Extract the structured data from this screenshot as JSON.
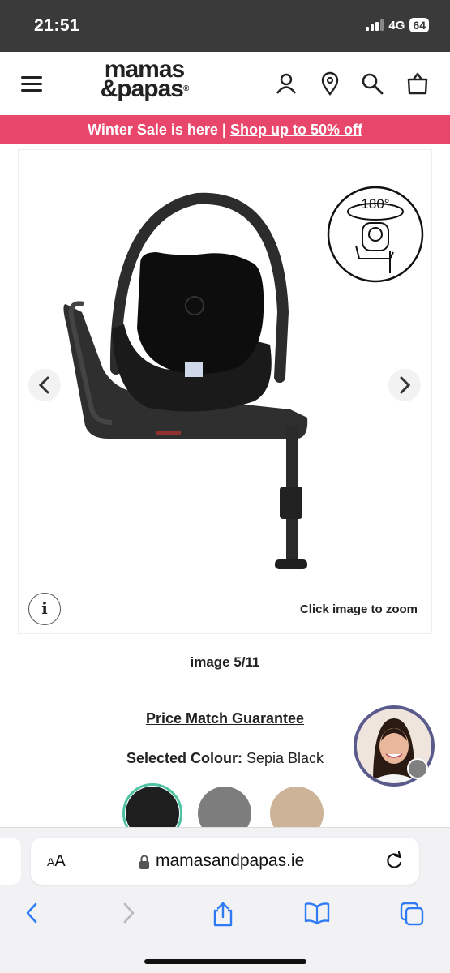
{
  "status_bar": {
    "time": "21:51",
    "network": "4G",
    "battery": "64"
  },
  "header": {
    "logo_line1": "mamas",
    "logo_line2": "&papas",
    "logo_reg": "®",
    "icons": [
      "menu-icon",
      "account-icon",
      "store-locator-icon",
      "search-icon",
      "bag-icon"
    ]
  },
  "promo": {
    "text": "Winter Sale is here | ",
    "link": "Shop up to 50% off",
    "color": "#e8476b"
  },
  "gallery": {
    "badge_text": "180°",
    "zoom_hint": "Click image to zoom",
    "info_label": "i"
  },
  "product": {
    "image_counter": "image 5/11",
    "price_match": "Price Match Guarantee",
    "selected_colour_label": "Selected Colour:",
    "selected_colour_value": "Sepia Black",
    "swatches": [
      {
        "name": "Sepia Black",
        "color": "#1e1e1e",
        "selected": true
      },
      {
        "name": "Grey",
        "color": "#7d7d7d",
        "selected": false
      },
      {
        "name": "Beige",
        "color": "#cdb498",
        "selected": false
      }
    ]
  },
  "browser": {
    "aa_label_small": "A",
    "aa_label_large": "A",
    "url": "mamasandpapas.ie"
  }
}
